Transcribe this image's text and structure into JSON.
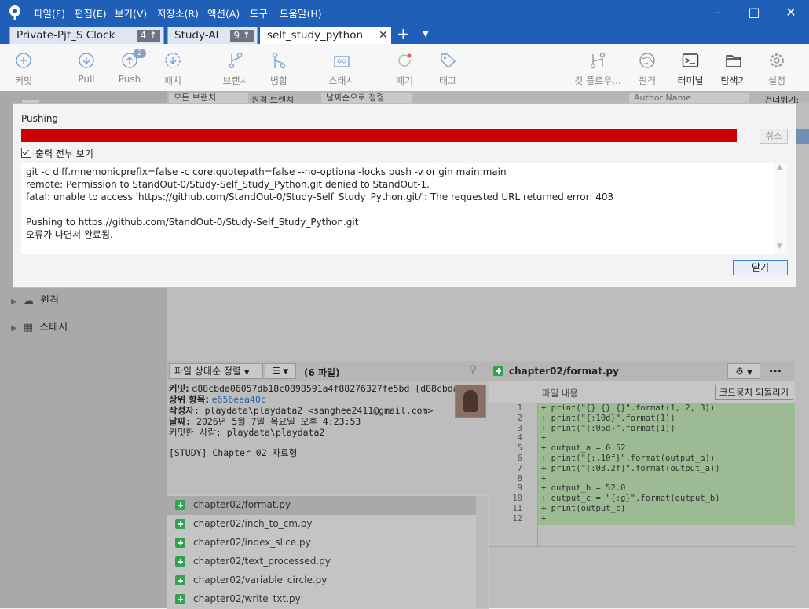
{
  "titlebar": {
    "menus": [
      "파일(F)",
      "편집(E)",
      "보기(V)",
      "저장소(R)",
      "액션(A)",
      "도구",
      "도움말(H)"
    ],
    "controls": [
      "minimize",
      "maximize",
      "close"
    ]
  },
  "tabs": [
    {
      "label": "Private-Pjt_S Clock",
      "badge": "4 ↑"
    },
    {
      "label": "Study-AI",
      "badge": "9 ↑"
    },
    {
      "label": "self_study_python",
      "active": true
    }
  ],
  "toolbar": {
    "left": [
      {
        "label": "커밋",
        "icon": "plus-circle-icon"
      },
      {
        "label": "Pull",
        "icon": "pull-icon"
      },
      {
        "label": "Push",
        "icon": "push-icon",
        "badge": "2"
      },
      {
        "label": "패치",
        "icon": "fetch-icon"
      },
      {
        "label": "브랜치",
        "icon": "branch-icon"
      },
      {
        "label": "병합",
        "icon": "merge-icon"
      },
      {
        "label": "스태시",
        "icon": "stash-icon"
      },
      {
        "label": "폐기",
        "icon": "discard-icon"
      },
      {
        "label": "태그",
        "icon": "tag-icon"
      }
    ],
    "right": [
      {
        "label": "깃 플로우...",
        "icon": "gitflow-icon"
      },
      {
        "label": "원격",
        "icon": "globe-icon"
      },
      {
        "label": "터미널",
        "icon": "terminal-icon"
      },
      {
        "label": "탐색기",
        "icon": "folder-icon"
      },
      {
        "label": "설정",
        "icon": "gear-icon"
      }
    ]
  },
  "background": {
    "history_filter": {
      "branches": "모든 브랜치",
      "remote_branches": "원격 브랜치",
      "sort": "날짜순으로 정렬",
      "author_placeholder": "Author Name",
      "skip": "건너뛰기:"
    },
    "sidebar": {
      "remote": "원격",
      "stash": "스태시"
    },
    "file_toolbar": {
      "sort": "파일 상태순 정렬",
      "count": "(6 파일)"
    },
    "commit": {
      "hash_label": "커밋:",
      "hash": "d88cbda06057db18c0898591a4f88276327fe5bd [d88cbda]",
      "parent_label": "상위 항목:",
      "parent": "e656eea40c",
      "author_label": "작성자:",
      "author": "playdata\\playdata2 <sanghee2411@gmail.com>",
      "date_label": "날짜:",
      "date": "2026년 5월 7일 목요일 오후 4:23:53",
      "committer_label": "커밋한 사람:",
      "committer": "playdata\\playdata2",
      "message": "[STUDY] Chapter 02 자료형"
    },
    "files": [
      "chapter02/format.py",
      "chapter02/inch_to_cm.py",
      "chapter02/index_slice.py",
      "chapter02/text_processed.py",
      "chapter02/variable_circle.py",
      "chapter02/write_txt.py"
    ],
    "diff": {
      "file": "chapter02/format.py",
      "header": "파일 내용",
      "revert_button": "코드뭉치 되돌리기",
      "lines": [
        {
          "n": "1",
          "t": "+ print(\"{} {} {}\".format(1, 2, 3))"
        },
        {
          "n": "2",
          "t": "+ print(\"{:10d}\".format(1))"
        },
        {
          "n": "3",
          "t": "+ print(\"{:05d}\".format(1))"
        },
        {
          "n": "4",
          "t": "+"
        },
        {
          "n": "5",
          "t": "+ output_a = 0.52"
        },
        {
          "n": "6",
          "t": "+ print(\"{:.10f}\".format(output_a))"
        },
        {
          "n": "7",
          "t": "+ print(\"{:03.2f}\".format(output_a))"
        },
        {
          "n": "8",
          "t": "+"
        },
        {
          "n": "9",
          "t": "+ output_b = 52.0"
        },
        {
          "n": "10",
          "t": "+ output_c = \"{:g}\".format(output_b)"
        },
        {
          "n": "11",
          "t": "+ print(output_c)"
        },
        {
          "n": "12",
          "t": "+"
        }
      ]
    }
  },
  "dialog": {
    "title": "Pushing",
    "progress_fraction": 1.0,
    "progress_color": "#cc0000",
    "cancel": "취소",
    "show_all_output": "출력 전부 보기",
    "log": [
      "git -c diff.mnemonicprefix=false -c core.quotepath=false --no-optional-locks push -v origin main:main",
      "remote: Permission to StandOut-0/Study-Self_Study_Python.git denied to StandOut-1.",
      "fatal: unable to access 'https://github.com/StandOut-0/Study-Self_Study_Python.git/': The requested URL returned error: 403",
      "",
      "Pushing to https://github.com/StandOut-0/Study-Self_Study_Python.git",
      "오류가 나면서 완료됨."
    ],
    "close": "닫기"
  }
}
